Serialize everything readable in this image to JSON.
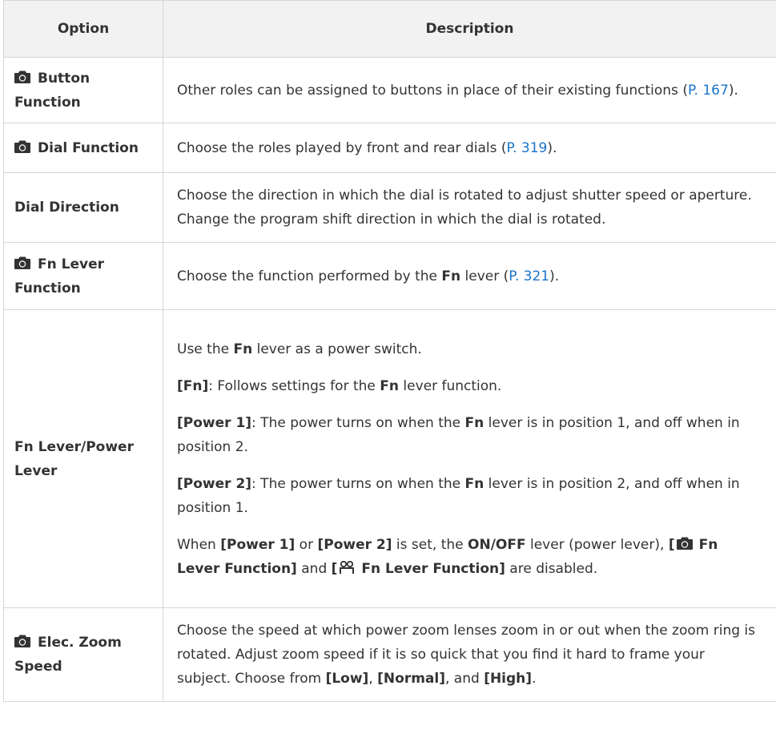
{
  "header": {
    "option": "Option",
    "description": "Description"
  },
  "rows": [
    {
      "option": "Button Function",
      "desc_text": "Other roles can be assigned to buttons in place of their existing functions (",
      "link": "P. 167",
      "desc_end": ")."
    },
    {
      "option": "Dial Function",
      "desc_text": "Choose the roles played by front and rear dials (",
      "link": "P. 319",
      "desc_end": ")."
    },
    {
      "option": "Dial Direction",
      "desc_text": "Choose the direction in which the dial is rotated to adjust shutter speed or aperture. Change the program shift direction in which the dial is rotated."
    },
    {
      "option": "Fn Lever Function",
      "desc_pre": "Choose the function performed by the ",
      "desc_bold": "Fn",
      "desc_mid": " lever (",
      "link": "P. 321",
      "desc_end": ")."
    },
    {
      "option": "Fn Lever/Power Lever",
      "p1_pre": "Use the ",
      "p1_bold": "Fn",
      "p1_post": " lever as a power switch.",
      "p2_label": "[Fn]",
      "p2_pre": ": Follows settings for the ",
      "p2_bold": "Fn",
      "p2_post": " lever function.",
      "p3_label": "[Power 1]",
      "p3_pre": ": The power turns on when the ",
      "p3_bold": "Fn",
      "p3_post": " lever is in position 1, and off when in position 2.",
      "p4_label": "[Power 2]",
      "p4_pre": ": The power turns on when the ",
      "p4_bold": "Fn",
      "p4_post": " lever is in position 2, and off when in position 1.",
      "p5_pre": "When ",
      "p5_b1": "[Power 1]",
      "p5_t1": " or ",
      "p5_b2": "[Power 2]",
      "p5_t2": " is set, the ",
      "p5_b3": "ON/OFF",
      "p5_t3": " lever (power lever), ",
      "p5_b4_open": "[",
      "p5_b4_text": "Fn Lever Function]",
      "p5_t4": " and ",
      "p5_b5_open": "[",
      "p5_b5_text": "Fn Lever Function]",
      "p5_t5": " are disabled."
    },
    {
      "option": "Elec. Zoom Speed",
      "desc_pre": "Choose the speed at which power zoom lenses zoom in or out when the zoom ring is rotated. Adjust zoom speed if it is so quick that you find it hard to frame your subject. Choose from ",
      "b1": "[Low]",
      "t1": ", ",
      "b2": "[Normal]",
      "t2": ", and ",
      "b3": "[High]",
      "t3": "."
    }
  ],
  "icons": {
    "camera": "camera-icon",
    "movie": "movie-icon"
  },
  "colors": {
    "link": "#1a73c8",
    "header_bg": "#f2f2f2",
    "border": "#d6d6d6",
    "text": "#333333"
  }
}
